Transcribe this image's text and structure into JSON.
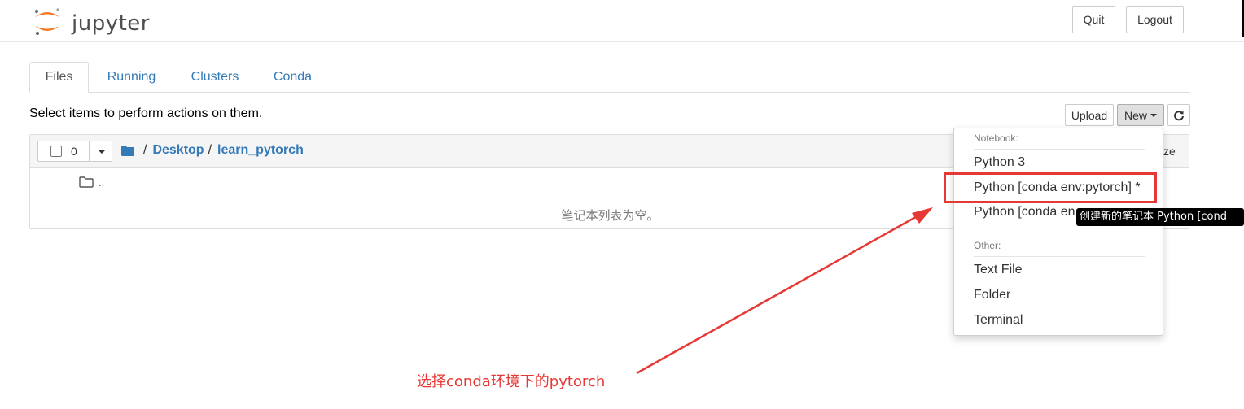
{
  "header": {
    "app_name": "jupyter",
    "quit_label": "Quit",
    "logout_label": "Logout"
  },
  "tabs": [
    {
      "label": "Files",
      "active": true
    },
    {
      "label": "Running",
      "active": false
    },
    {
      "label": "Clusters",
      "active": false
    },
    {
      "label": "Conda",
      "active": false
    }
  ],
  "toolbar": {
    "select_message": "Select items to perform actions on them.",
    "upload_label": "Upload",
    "new_label": "New",
    "refresh_icon": "refresh-icon"
  },
  "file_list": {
    "selected_count": "0",
    "breadcrumb": [
      "Desktop",
      "learn_pytorch"
    ],
    "breadcrumb_sep": "/",
    "parent_dir": "..",
    "empty_message": "笔记本列表为空。",
    "hidden_button_fragment": "ze"
  },
  "new_menu": {
    "notebook_header": "Notebook:",
    "notebook_items": [
      "Python 3",
      "Python [conda env:pytorch] *",
      "Python [conda en"
    ],
    "other_header": "Other:",
    "other_items": [
      "Text File",
      "Folder",
      "Terminal"
    ]
  },
  "tooltip": "创建新的笔记本 Python [cond",
  "annotation": "选择conda环境下的pytorch",
  "colors": {
    "link": "#337ab7",
    "annotation_red": "#e53935",
    "jupyter_orange": "#f37726"
  }
}
